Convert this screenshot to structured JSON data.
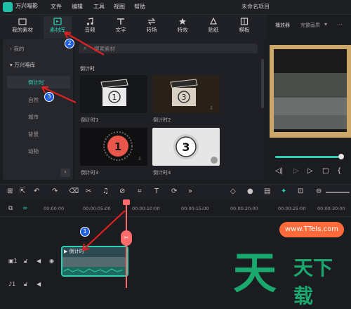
{
  "titlebar": {
    "app_name": "万兴喵影",
    "menus": [
      "文件",
      "编辑",
      "工具",
      "视图",
      "帮助"
    ],
    "project_name": "未命名项目"
  },
  "toolbar": {
    "tabs": [
      {
        "label": "我的素材",
        "icon": "folder-icon"
      },
      {
        "label": "素材库",
        "icon": "media-library-icon"
      },
      {
        "label": "音频",
        "icon": "music-note-icon"
      },
      {
        "label": "文字",
        "icon": "text-icon"
      },
      {
        "label": "转场",
        "icon": "transition-icon"
      },
      {
        "label": "特效",
        "icon": "effects-icon"
      },
      {
        "label": "贴纸",
        "icon": "sticker-icon"
      },
      {
        "label": "模板",
        "icon": "template-icon"
      }
    ],
    "active_tab": "素材库"
  },
  "sidebar": {
    "mine": "我的",
    "library": "万兴喵库",
    "items": [
      "倒计时",
      "自然",
      "城市",
      "背景",
      "动物"
    ],
    "active_item": "倒计时"
  },
  "content": {
    "search_placeholder": "搜索素材",
    "section_title": "倒计时",
    "thumbs": [
      {
        "label": "倒计时1",
        "number": "1"
      },
      {
        "label": "倒计时2",
        "number": "3"
      },
      {
        "label": "倒计时3",
        "number": "1"
      },
      {
        "label": "倒计时4",
        "number": "3"
      }
    ]
  },
  "player": {
    "label": "播放器",
    "quality": "完整画质",
    "progress": 0.93
  },
  "timeline": {
    "ticks": [
      "00:00:00",
      "00:00:05:00",
      "00:00:10:00",
      "00:00:15:00",
      "00:00:20:00",
      "00:00:25:00",
      "00:00:30:00"
    ],
    "clip_label": "倒计时"
  },
  "annotations": {
    "badge1": "1",
    "badge2": "2",
    "badge3": "3"
  },
  "watermark": {
    "url": "www.TTeIs.com",
    "big": "天",
    "small": "天下载"
  },
  "colors": {
    "accent": "#2bd0b2",
    "playhead": "#ff6a6a",
    "badge": "#1f5fe0",
    "arrow": "#e02020"
  }
}
